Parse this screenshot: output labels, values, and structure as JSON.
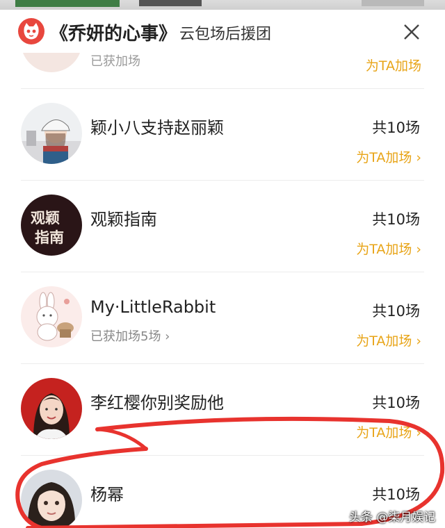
{
  "header": {
    "title": "《乔妍的心事》",
    "subtitle": "云包场后援团",
    "logo_icon": "cat-logo-icon",
    "close_icon": "close-icon"
  },
  "partial_item": {
    "earned": "已获加场",
    "add_label": "为TA加场"
  },
  "items": [
    {
      "name": "颖小八支持赵丽颖",
      "count": "共10场",
      "add_label": "为TA加场 ›",
      "earned": "",
      "avatar_icon": "avatar-cartoon-girl-icon"
    },
    {
      "name": "观颖指南",
      "count": "共10场",
      "add_label": "为TA加场 ›",
      "earned": "",
      "avatar_icon": "avatar-text-logo-icon",
      "avatar_text_top": "观颖",
      "avatar_text_bottom": "指南"
    },
    {
      "name": "My·LittleRabbit",
      "count": "共10场",
      "add_label": "为TA加场 ›",
      "earned": "已获加场5场 ›",
      "avatar_icon": "avatar-rabbit-icon"
    },
    {
      "name": "李红樱你别奖励他",
      "count": "共10场",
      "add_label": "为TA加场 ›",
      "earned": "",
      "avatar_icon": "avatar-photo-woman-icon"
    },
    {
      "name": "杨幂",
      "count": "共10场",
      "add_label": "",
      "earned": "",
      "avatar_icon": "avatar-photo-child-icon"
    }
  ],
  "colors": {
    "accent": "#e8a417",
    "logo_red": "#e8473e",
    "marker_red": "#e8332e"
  },
  "watermark": "头条 @柒月娱记"
}
